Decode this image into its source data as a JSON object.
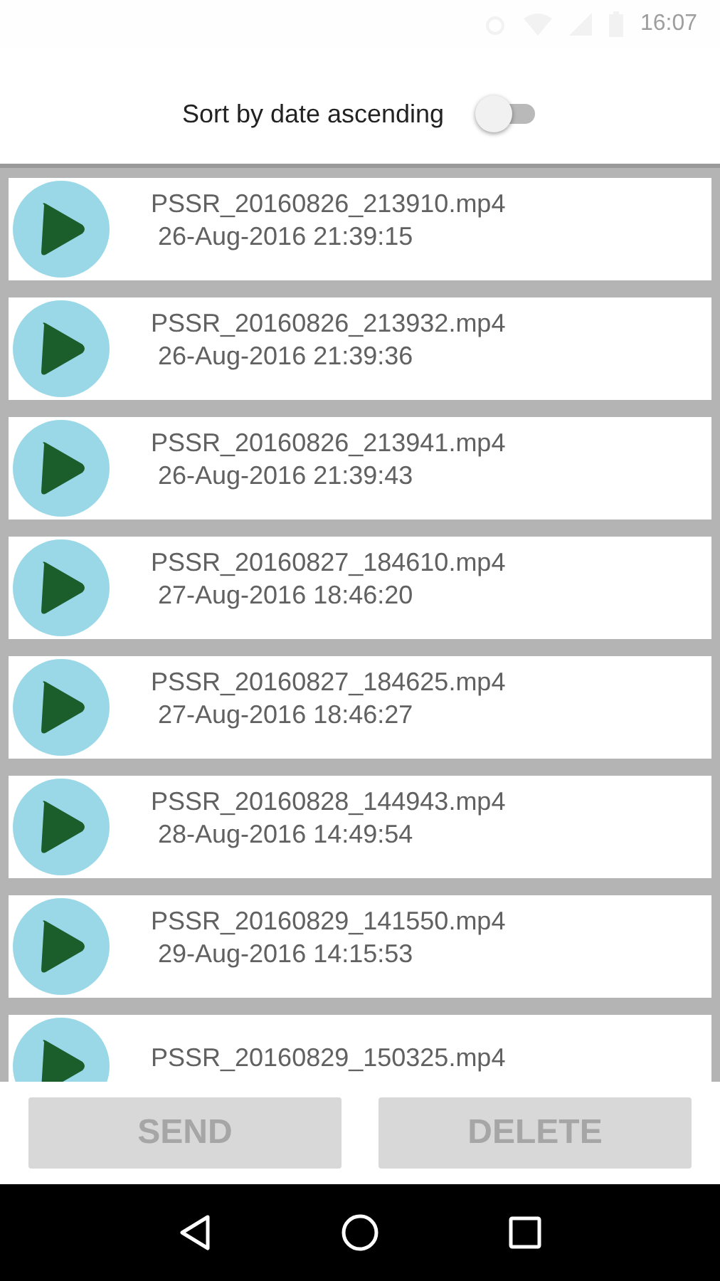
{
  "status_bar": {
    "time": "16:07"
  },
  "sort_toggle": {
    "label": "Sort by date ascending",
    "on": false
  },
  "recordings": [
    {
      "filename": "PSSR_20160826_213910.mp4",
      "date": "26-Aug-2016 21:39:15"
    },
    {
      "filename": "PSSR_20160826_213932.mp4",
      "date": "26-Aug-2016 21:39:36"
    },
    {
      "filename": "PSSR_20160826_213941.mp4",
      "date": "26-Aug-2016 21:39:43"
    },
    {
      "filename": "PSSR_20160827_184610.mp4",
      "date": "27-Aug-2016 18:46:20"
    },
    {
      "filename": "PSSR_20160827_184625.mp4",
      "date": "27-Aug-2016 18:46:27"
    },
    {
      "filename": "PSSR_20160828_144943.mp4",
      "date": "28-Aug-2016 14:49:54"
    },
    {
      "filename": "PSSR_20160829_141550.mp4",
      "date": "29-Aug-2016 14:15:53"
    },
    {
      "filename": "PSSR_20160829_150325.mp4"
    }
  ],
  "buttons": [
    {
      "label": "SEND",
      "disabled": true
    },
    {
      "label": "DELETE",
      "disabled": true
    }
  ]
}
